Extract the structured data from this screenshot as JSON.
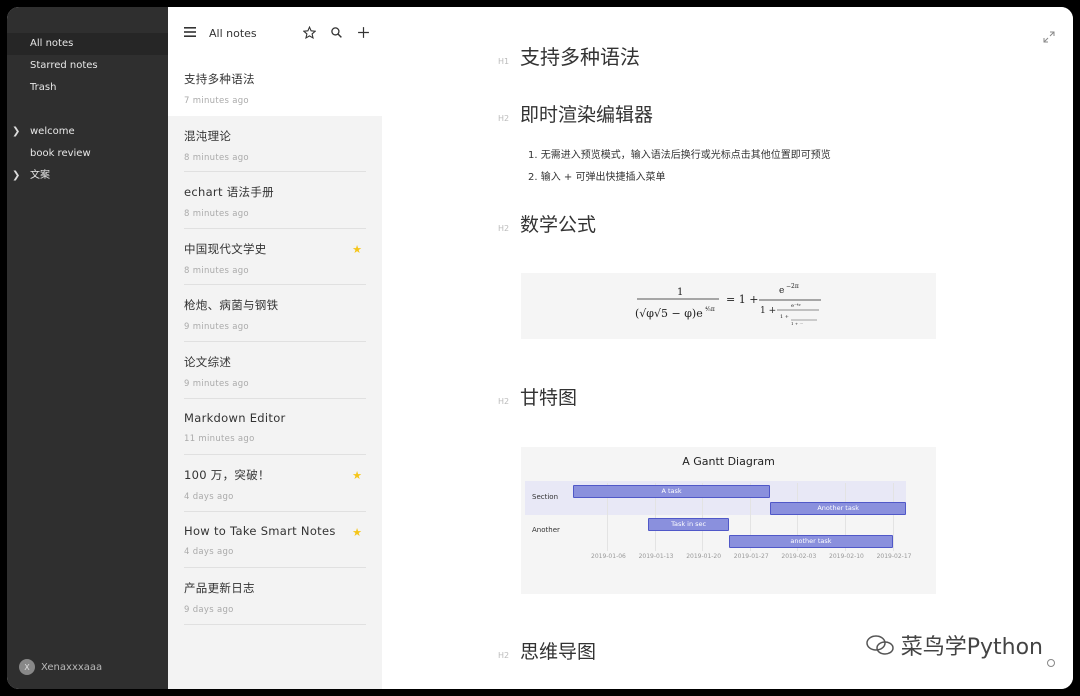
{
  "sidebar": {
    "nav": [
      {
        "label": "All notes",
        "active": true
      },
      {
        "label": "Starred notes",
        "active": false
      },
      {
        "label": "Trash",
        "active": false
      }
    ],
    "folders": [
      {
        "label": "welcome",
        "expandable": true
      },
      {
        "label": "book review",
        "expandable": false
      },
      {
        "label": "文案",
        "expandable": true
      }
    ],
    "user": {
      "initial": "X",
      "name": "Xenaxxxaaa"
    }
  },
  "note_list": {
    "header_title": "All notes",
    "icons": [
      "menu-icon",
      "star-outline-icon",
      "search-icon",
      "plus-icon"
    ],
    "notes": [
      {
        "title": "支持多种语法",
        "time": "7 minutes ago",
        "starred": false
      },
      {
        "title": "混沌理论",
        "time": "8 minutes ago",
        "starred": false
      },
      {
        "title": "echart 语法手册",
        "time": "8 minutes ago",
        "starred": false
      },
      {
        "title": "中国现代文学史",
        "time": "8 minutes ago",
        "starred": true
      },
      {
        "title": "枪炮、病菌与钢铁",
        "time": "9 minutes ago",
        "starred": false
      },
      {
        "title": "论文综述",
        "time": "9 minutes ago",
        "starred": false
      },
      {
        "title": "Markdown Editor",
        "time": "11 minutes ago",
        "starred": false
      },
      {
        "title": "100 万，突破！",
        "time": "4 days ago",
        "starred": true
      },
      {
        "title": "How to Take Smart Notes",
        "time": "4 days ago",
        "starred": true
      },
      {
        "title": "产品更新日志",
        "time": "9 days ago",
        "starred": false
      }
    ]
  },
  "editor": {
    "h1": {
      "tag": "H1",
      "text": "支持多种语法"
    },
    "sections": [
      {
        "tag": "H2",
        "text": "即时渲染编辑器"
      },
      {
        "tag": "H2",
        "text": "数学公式"
      },
      {
        "tag": "H2",
        "text": "甘特图"
      },
      {
        "tag": "H2",
        "text": "思维导图"
      }
    ],
    "list": [
      "1. 无需进入预览模式，输入语法后换行或光标点击其他位置即可预览",
      "2. 输入 + 可弹出快捷插入菜单"
    ],
    "gantt": {
      "title": "A Gantt Diagram",
      "sections": [
        "Section",
        "Another"
      ],
      "tasks": [
        {
          "label": "A task",
          "start": "2019-01-01",
          "end": "2019-01-30"
        },
        {
          "label": "Another task",
          "start": "2019-01-30",
          "end": "2019-02-19"
        },
        {
          "label": "Task in sec",
          "start": "2019-01-12",
          "end": "2019-01-24"
        },
        {
          "label": "another task",
          "start": "2019-01-24",
          "end": "2019-02-17"
        }
      ],
      "ticks": [
        "2019-01-06",
        "2019-01-13",
        "2019-01-20",
        "2019-01-27",
        "2019-02-03",
        "2019-02-10",
        "2019-02-17"
      ]
    },
    "watermark": "菜鸟学Python"
  },
  "colors": {
    "sidebar_bg": "#2f2f2f",
    "list_bg": "#f3f3f3",
    "star": "#f5c518",
    "gantt_bar": "#8a90dd"
  }
}
